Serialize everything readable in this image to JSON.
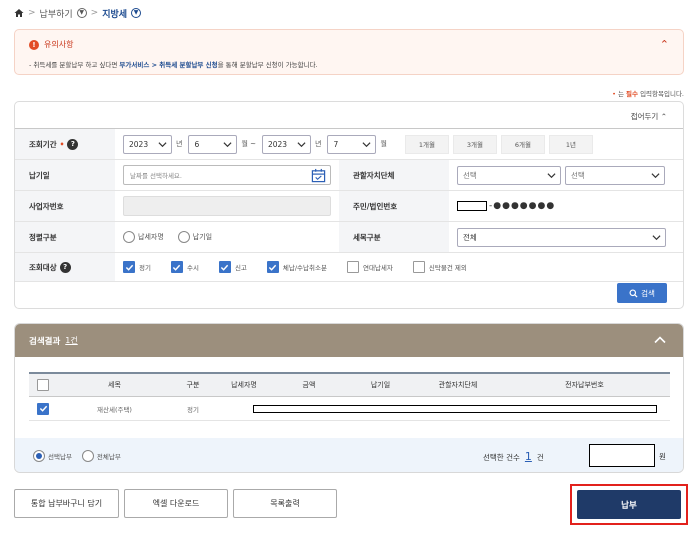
{
  "breadcrumb": {
    "level1": "납부하기",
    "level2": "지방세"
  },
  "notice": {
    "title": "유의사항",
    "text_prefix": "- 취득세를 분할납부 하고 싶다면 ",
    "text_link": "부가서비스 > 취득세 분할납부 신청",
    "text_suffix": "을 통해 분할납부 신청이 가능합니다."
  },
  "required_note": {
    "dot": "•",
    "prefix": " 는 ",
    "must": "필수",
    "suffix": " 입력항목입니다."
  },
  "form": {
    "collapse_label": "접어두기",
    "period": {
      "label": "조회기간",
      "from_year": "2023",
      "from_month": "6",
      "to_year": "2023",
      "to_month": "7",
      "unit_year": "년",
      "unit_month": "월",
      "unit_month_tilde": "월 ~",
      "quick": [
        "1개월",
        "3개월",
        "6개월",
        "1년"
      ]
    },
    "due_date": {
      "label": "납기일",
      "placeholder": "날짜를 선택하세요."
    },
    "agency": {
      "label": "관할자치단체",
      "select1": "선택",
      "select2": "선택"
    },
    "biz_no": {
      "label": "사업자번호"
    },
    "resident_no": {
      "label": "주민/법인번호",
      "masked": "-●●●●●●●"
    },
    "sort": {
      "label": "정렬구분",
      "opt1": "납세자명",
      "opt2": "납기일"
    },
    "tax_item": {
      "label": "세목구분",
      "value": "전체"
    },
    "target": {
      "label": "조회대상",
      "items": [
        {
          "label": "정기",
          "checked": true
        },
        {
          "label": "수시",
          "checked": true
        },
        {
          "label": "신고",
          "checked": true
        },
        {
          "label": "체납/수납취소분",
          "checked": true
        },
        {
          "label": "연대납세자",
          "checked": false
        },
        {
          "label": "신탁물건 제외",
          "checked": false
        }
      ]
    },
    "search_label": "검색"
  },
  "results": {
    "title": "검색결과",
    "count": "1건",
    "columns": [
      "세목",
      "구분",
      "납세자명",
      "금액",
      "납기일",
      "관할자치단체",
      "전자납부번호"
    ],
    "row": {
      "tax_item": "재산세(주택)",
      "type": "정기"
    },
    "footer": {
      "opt1": "선택납부",
      "opt2": "전체납부",
      "selected_label": "선택한 건수",
      "selected_count": "1",
      "selected_unit": "건",
      "amount_unit": "원"
    }
  },
  "buttons": {
    "cart": "통합 납부바구니 담기",
    "excel": "엑셀 다운로드",
    "print": "목록출력",
    "pay": "납부"
  }
}
